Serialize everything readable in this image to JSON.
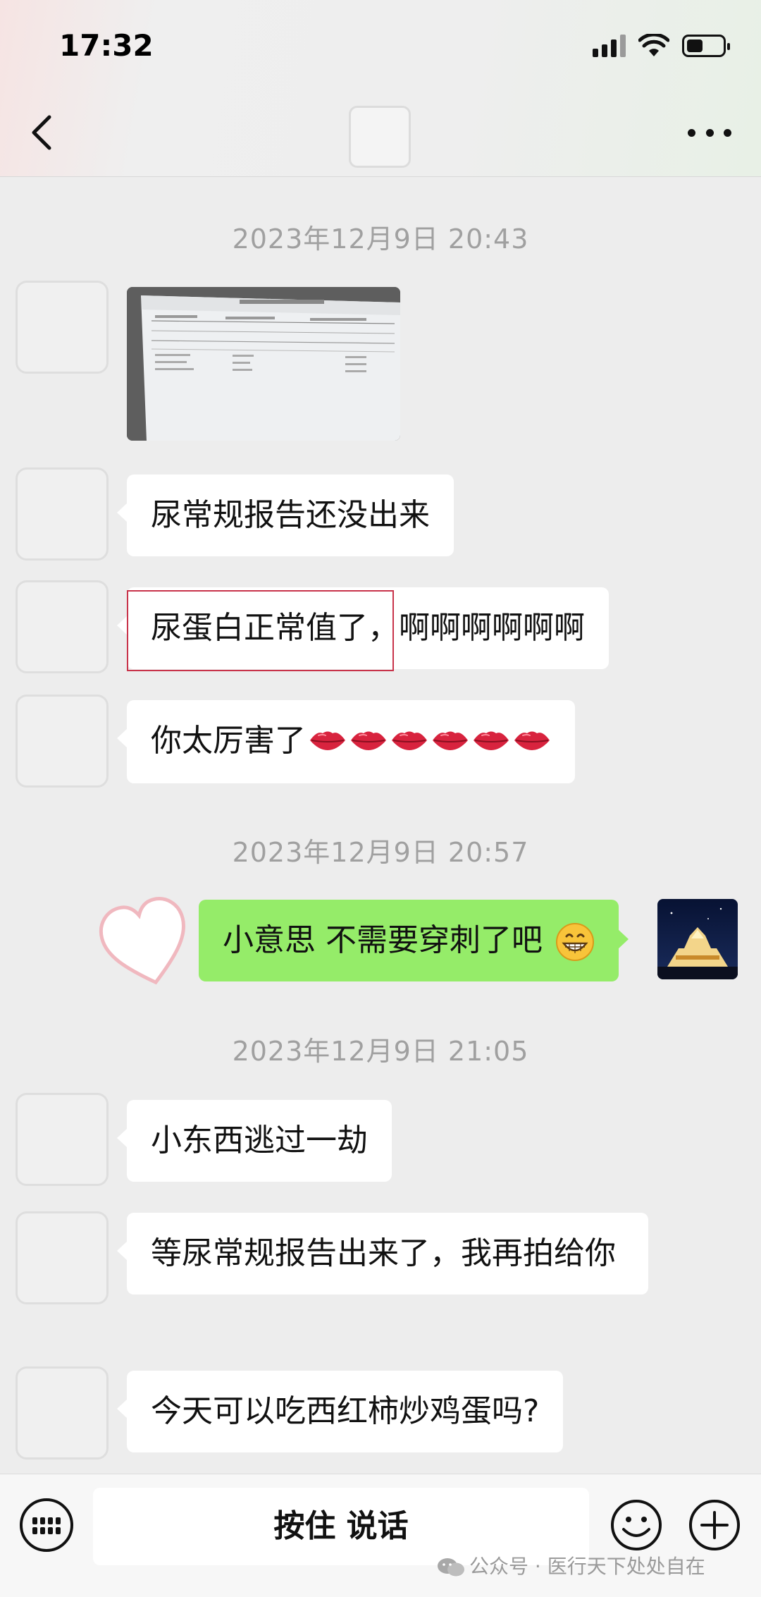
{
  "status_bar": {
    "time": "17:32",
    "battery_level": 0.45
  },
  "header": {
    "back_icon": "chevron-left-icon",
    "more_icon": "more-dots-icon"
  },
  "timestamps": [
    "2023年12月9日 20:43",
    "2023年12月9日 20:57",
    "2023年12月9日 21:05"
  ],
  "messages": [
    {
      "side": "left",
      "type": "image",
      "image": "lab-report-photo"
    },
    {
      "side": "left",
      "type": "text",
      "text": "尿常规报告还没出来"
    },
    {
      "side": "left",
      "type": "text",
      "text": "尿蛋白正常值了，啊啊啊啊啊啊"
    },
    {
      "side": "left",
      "type": "text",
      "text": "你太厉害了",
      "emoji": "lips-emoji",
      "emoji_count": 6
    },
    {
      "side": "right",
      "type": "text",
      "text": "小意思 不需要穿刺了吧",
      "emoji": "grin-emoji"
    },
    {
      "side": "left",
      "type": "text",
      "text": "小东西逃过一劫"
    },
    {
      "side": "left",
      "type": "text",
      "text": "等尿常规报告出来了，我再拍给你"
    },
    {
      "side": "left",
      "type": "text",
      "text": "今天可以吃西红柿炒鸡蛋吗?"
    }
  ],
  "input_bar": {
    "hold_to_talk": "按住 说话",
    "keyboard_icon": "keyboard-icon",
    "emoji_icon": "smiley-icon",
    "plus_icon": "plus-circle-icon"
  },
  "watermark": {
    "text": "公众号 · 医行天下处处自在"
  },
  "colors": {
    "background": "#ededed",
    "my_bubble": "#95ec69",
    "their_bubble": "#ffffff",
    "highlight_border": "#c8334a",
    "timestamp": "#a0a0a0"
  }
}
